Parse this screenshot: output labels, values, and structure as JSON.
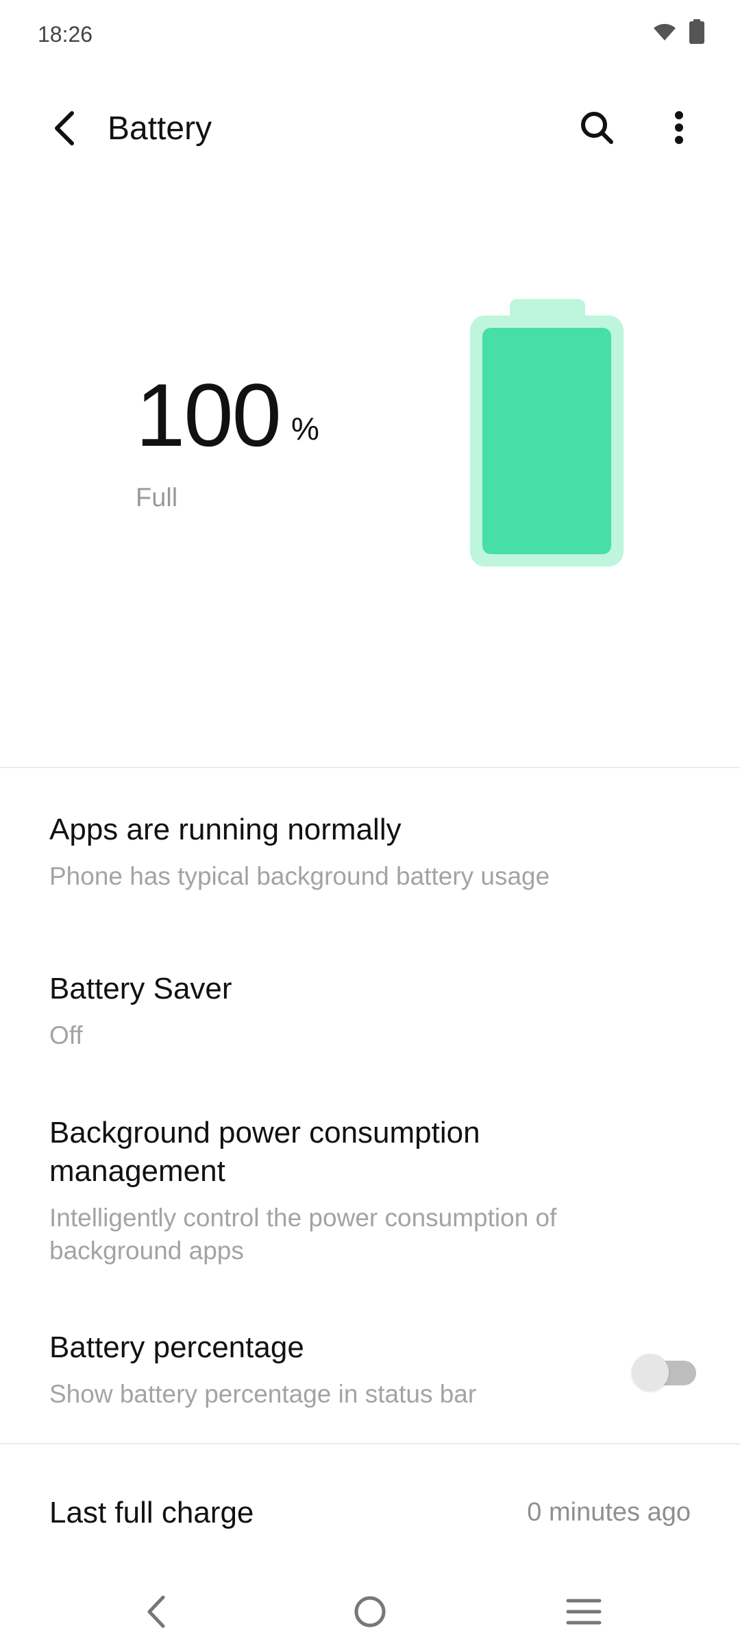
{
  "status_bar": {
    "time": "18:26",
    "icons": [
      "wifi-icon",
      "battery-icon"
    ]
  },
  "header": {
    "title": "Battery",
    "icons": [
      "back-arrow-icon",
      "search-icon",
      "more-vert-icon"
    ]
  },
  "battery": {
    "percent_value": "100",
    "percent_unit": "%",
    "state": "Full",
    "level_fraction": 1.0,
    "colors": {
      "outer": "#bdf5dd",
      "fill": "#48dea8"
    }
  },
  "settings": {
    "apps_status": {
      "title": "Apps are running normally",
      "subtitle": "Phone has typical background battery usage"
    },
    "battery_saver": {
      "title": "Battery Saver",
      "subtitle": "Off"
    },
    "background_power": {
      "title": "Background power consumption management",
      "subtitle": "Intelligently control the power consumption of background apps"
    },
    "battery_percentage": {
      "title": "Battery percentage",
      "subtitle": "Show battery percentage in status bar",
      "toggle_on": false
    },
    "last_full_charge": {
      "title": "Last full charge",
      "value": "0 minutes ago"
    }
  },
  "nav_bar": {
    "icons": [
      "nav-back-icon",
      "nav-home-icon",
      "nav-recents-icon"
    ]
  }
}
